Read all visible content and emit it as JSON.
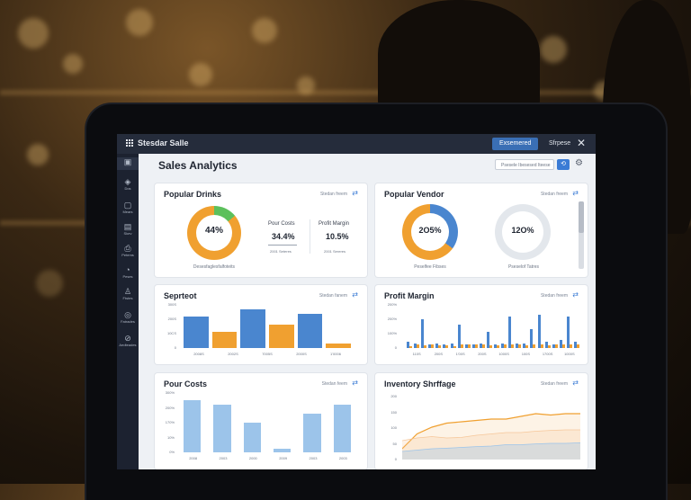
{
  "window": {
    "app_name": "Stesdar Salle",
    "btn_primary": "Exsemered",
    "btn_secondary": "Sfrpese",
    "close": "✕"
  },
  "sidebar": {
    "items": [
      {
        "icon": "▣",
        "label": ""
      },
      {
        "icon": "◈",
        "label": "Dos"
      },
      {
        "icon": "▢",
        "label": "Mears"
      },
      {
        "icon": "▤",
        "label": "Skev"
      },
      {
        "icon": "⎙",
        "label": "Petems"
      },
      {
        "icon": "◔",
        "label": "Peses"
      },
      {
        "icon": "♙",
        "label": "Ftstes"
      },
      {
        "icon": "◎",
        "label": "Fatrades"
      },
      {
        "icon": "⊘",
        "label": "Aedteades"
      }
    ]
  },
  "header": {
    "title": "Sales Analytics",
    "search_value": "Psesele Ibesesed Iteese",
    "button_icon": "⟲",
    "gear_icon": "⚙"
  },
  "colors": {
    "blue": "#4a86cf",
    "orange": "#f0a030",
    "green": "#5cc05c",
    "light_blue": "#9cc4ea",
    "gray_ring": "#e3e7ec"
  },
  "cards": {
    "popular_drinks": {
      "title": "Popular Drinks",
      "link": "Stedan freem",
      "donut": {
        "value": "44%",
        "caption": "Desesfaglesfalfoteits",
        "fraction": 0.44,
        "green_fraction": 0.14
      },
      "stats": [
        {
          "label": "Pour Costs",
          "value": "34.4%",
          "sub": "2001 Seteres"
        },
        {
          "label": "Profit Margin",
          "value": "10.5%",
          "sub": "2001 Sereres"
        }
      ]
    },
    "popular_vendor": {
      "title": "Popular Vendor",
      "link": "Stedan freem",
      "donut1": {
        "value": "2O5%",
        "caption": "Peselfee Fibses",
        "fraction": 0.35
      },
      "donut2": {
        "value": "12O%",
        "caption": "Pseselof Tatres",
        "fraction": 0.0
      }
    },
    "sepmteet": {
      "title": "Seprteot",
      "link": "Stedan fanem",
      "yticks": [
        "300S",
        "200S",
        "10CS",
        "0"
      ],
      "xticks": [
        "2008S",
        "2002S",
        "7005S",
        "2000S",
        "1'0006"
      ]
    },
    "profit_margin": {
      "title": "Profit Margin",
      "link": "Stedan freem",
      "yticks": [
        "200%",
        "200%",
        "100%",
        "0"
      ],
      "xticks": [
        "110S",
        "200S",
        "1'00S",
        "200S",
        "1000S",
        "100S",
        "1700S",
        "1000S"
      ]
    },
    "pour_costs": {
      "title": "Pour Costs",
      "link": "Stedan feem",
      "yticks": [
        "300%",
        "200%",
        "170%",
        "10%",
        "0%"
      ],
      "xticks": [
        "2008",
        "2003",
        "2000",
        "2009",
        "2003",
        "2003"
      ]
    },
    "inventory": {
      "title": "Inventory Shrffage",
      "link": "Stedan freem",
      "yticks": [
        "200",
        "150",
        "100",
        "50",
        "0"
      ]
    }
  },
  "chart_data": [
    {
      "type": "bar",
      "categories": [
        "2008S",
        "2002S",
        "7005S",
        "2000S",
        "1'0006"
      ],
      "series": [
        {
          "values": [
            220,
            null,
            270,
            null,
            235,
            null
          ]
        },
        {
          "values": [
            null,
            110,
            null,
            160,
            null,
            30
          ]
        }
      ],
      "ylim": [
        0,
        300
      ]
    },
    {
      "type": "bar",
      "series": [
        {
          "values": [
            40,
            30,
            180,
            25,
            30,
            20,
            30,
            150,
            25,
            20,
            30,
            100,
            20,
            30,
            200,
            30,
            30,
            120,
            210,
            40,
            20,
            50,
            200,
            40
          ]
        },
        {
          "values": [
            10,
            25,
            18,
            20,
            18,
            15,
            10,
            22,
            20,
            25,
            20,
            18,
            15,
            20,
            22,
            20,
            18,
            20,
            20,
            15,
            20,
            20,
            22,
            20
          ]
        }
      ],
      "ylim": [
        0,
        300
      ]
    },
    {
      "type": "bar",
      "categories": [
        "2008",
        "2003",
        "2000",
        "2009",
        "2003",
        "2003"
      ],
      "values": [
        265,
        240,
        150,
        20,
        195,
        240
      ],
      "ylim": [
        0,
        300
      ]
    },
    {
      "type": "area",
      "series": [
        {
          "values": [
            40,
            95,
            120,
            135,
            140,
            145,
            150,
            150,
            160,
            170,
            165,
            170,
            170
          ]
        },
        {
          "values": [
            70,
            80,
            85,
            80,
            82,
            90,
            95,
            100,
            100,
            105,
            108,
            110,
            110
          ]
        },
        {
          "values": [
            30,
            35,
            40,
            42,
            45,
            48,
            50,
            55,
            55,
            58,
            60,
            60,
            62
          ]
        }
      ],
      "ylim": [
        0,
        200
      ]
    }
  ]
}
